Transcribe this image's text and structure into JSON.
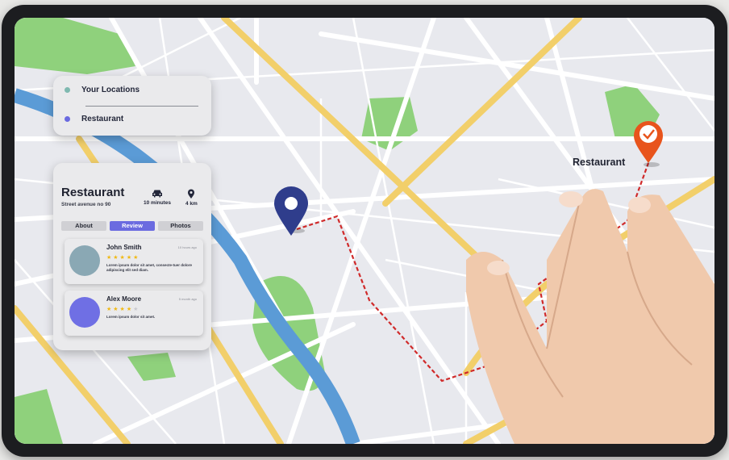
{
  "locations_card": {
    "items": [
      {
        "label": "Your Locations",
        "dot_color": "#7fb9b0"
      },
      {
        "label": "Restaurant",
        "dot_color": "#6a6ae0"
      }
    ]
  },
  "restaurant_card": {
    "title": "Restaurant",
    "address": "Street avenue no 90",
    "time": "10 minutes",
    "distance": "4 km",
    "tabs": [
      {
        "label": "About",
        "active": false
      },
      {
        "label": "Review",
        "active": true
      },
      {
        "label": "Photos",
        "active": false
      }
    ],
    "reviews": [
      {
        "name": "John Smith",
        "time": "10 hours ago",
        "rating": 5,
        "text": "Lorem ipsum dolor sit amet, consecte-tuer dolore adipiscing elit sed diam.",
        "avatar_color": "#8aa8b4"
      },
      {
        "name": "Alex Moore",
        "time": "5 month ago",
        "rating": 4,
        "text": "Lorem ipsum dolor sit amet.",
        "avatar_color": "#6f6fe4"
      }
    ]
  },
  "map": {
    "destination_label": "Restaurant",
    "colors": {
      "background": "#e8e9ee",
      "major_road": "#f2cf6a",
      "minor_road": "#ffffff",
      "river": "#5b9bd6",
      "park": "#8fd17c",
      "route": "#d02a2a",
      "origin_pin": "#2f3d8c",
      "destination_pin": "#e8541c"
    }
  }
}
